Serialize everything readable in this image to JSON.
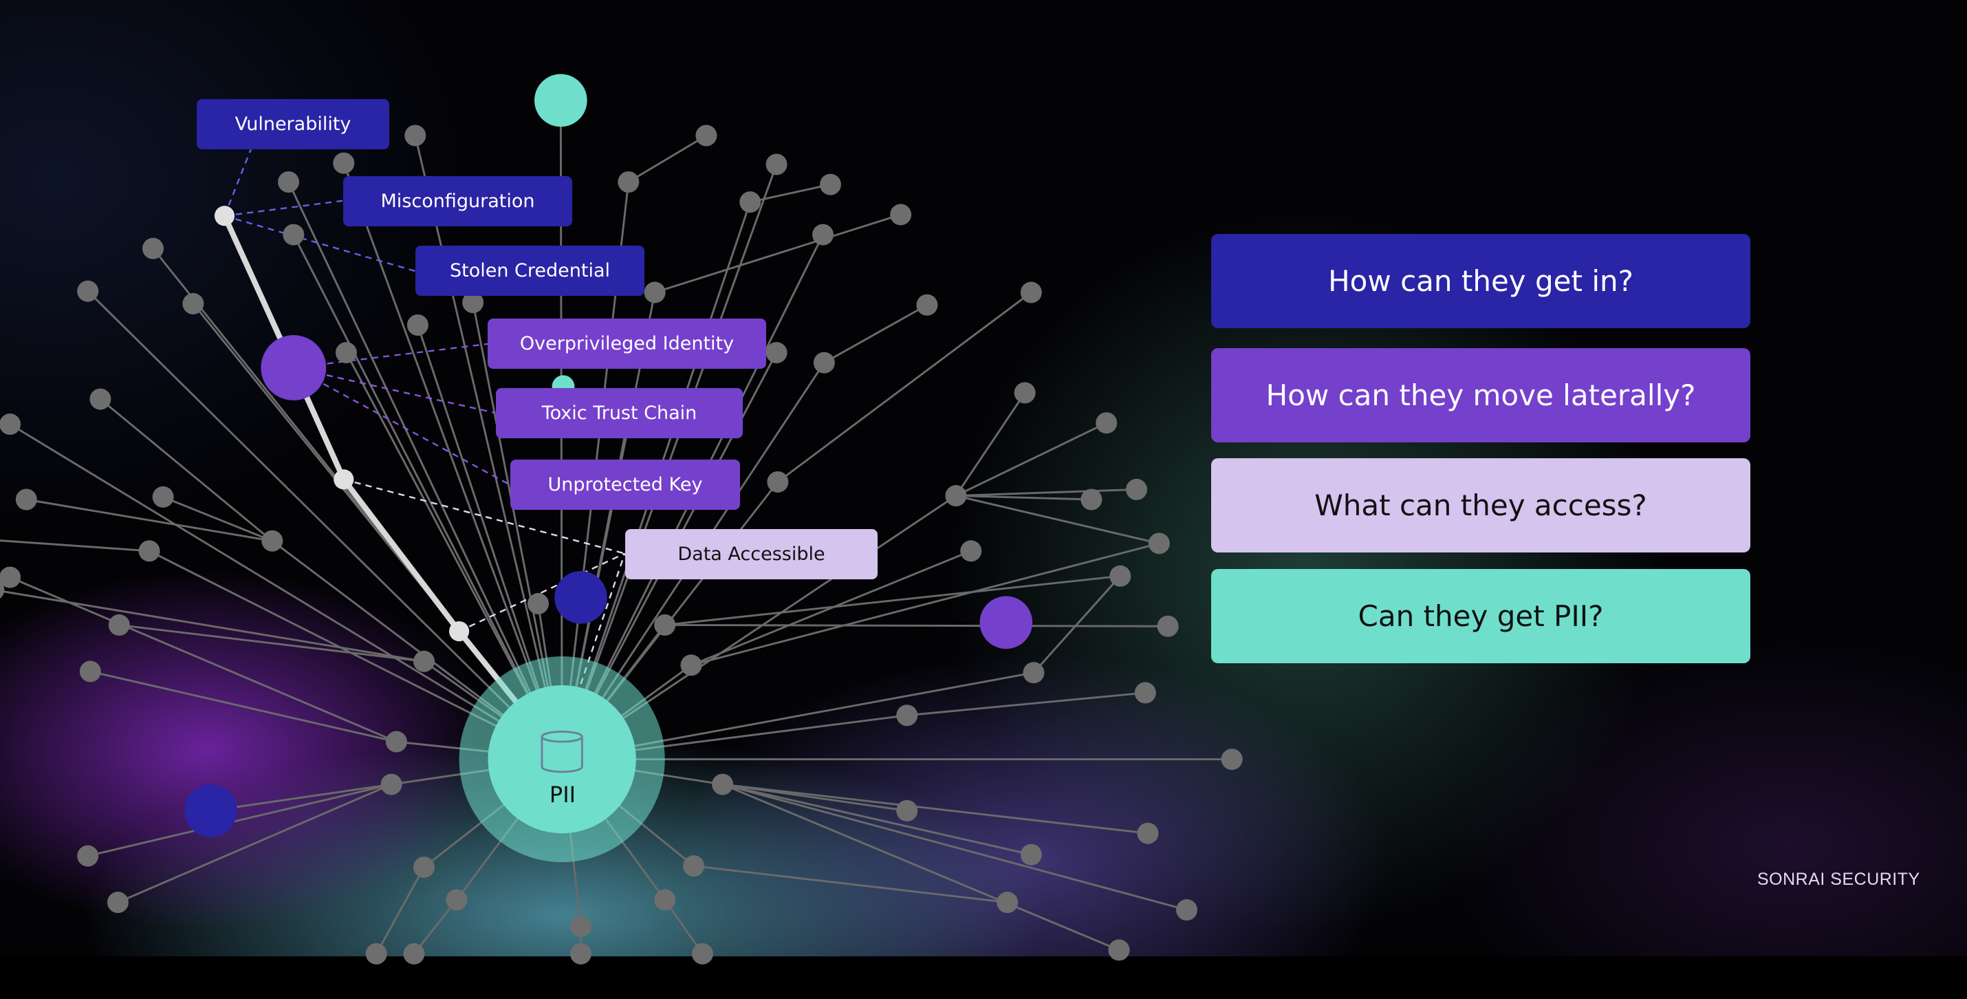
{
  "colors": {
    "navy": "#2a24a6",
    "purple": "#7540cc",
    "lavender": "#d5c4ee",
    "teal": "#6fdfcc",
    "gray_node": "#6e6e6e",
    "edge": "#6a6a6a",
    "path_white": "#d8d8d8"
  },
  "diagram": {
    "center_node": {
      "label": "PII",
      "icon": "database-icon"
    },
    "labels": [
      {
        "id": "vulnerability",
        "text": "Vulnerability",
        "category": "entry"
      },
      {
        "id": "misconfiguration",
        "text": "Misconfiguration",
        "category": "entry"
      },
      {
        "id": "stolen-credential",
        "text": "Stolen Credential",
        "category": "entry"
      },
      {
        "id": "overprivileged-identity",
        "text": "Overprivileged Identity",
        "category": "lateral"
      },
      {
        "id": "toxic-trust-chain",
        "text": "Toxic Trust Chain",
        "category": "lateral"
      },
      {
        "id": "unprotected-key",
        "text": "Unprotected Key",
        "category": "lateral"
      },
      {
        "id": "data-accessible",
        "text": "Data Accessible",
        "category": "access"
      }
    ]
  },
  "questions": [
    {
      "text": "How can they get in?",
      "category": "entry"
    },
    {
      "text": "How can they move laterally?",
      "category": "lateral"
    },
    {
      "text": "What can they access?",
      "category": "access"
    },
    {
      "text": "Can they get PII?",
      "category": "pii"
    }
  ],
  "brand": "SONRAI SECURITY"
}
